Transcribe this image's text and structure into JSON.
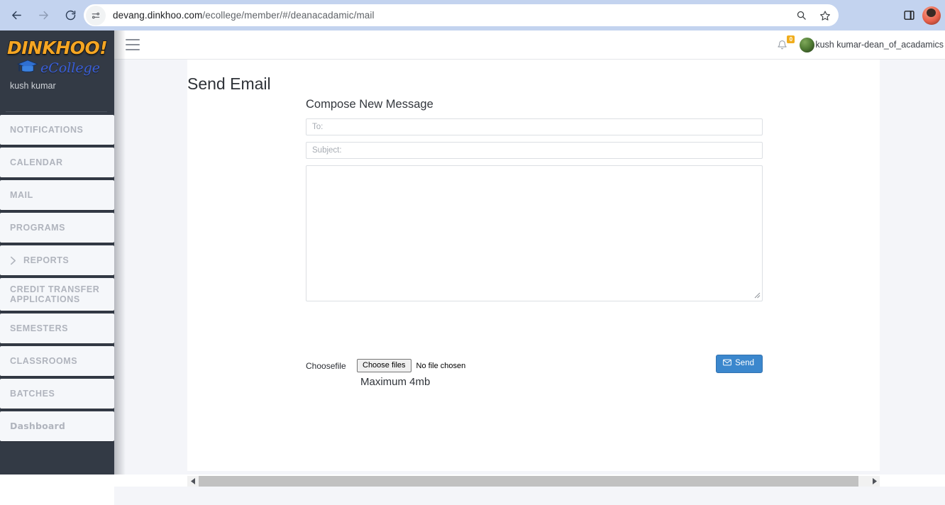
{
  "browser": {
    "url_bold": "devang.dinkhoo.com",
    "url_rest": "/ecollege/member/#/deanacadamic/mail",
    "back_icon": "back-arrow-icon",
    "forward_icon": "forward-arrow-icon",
    "reload_icon": "reload-icon",
    "site_info_icon": "site-settings-icon",
    "zoom_icon": "search-icon",
    "bookmark_icon": "bookmark-star-icon",
    "side_panel_icon": "side-panel-icon",
    "profile_icon": "profile-avatar"
  },
  "sidebar": {
    "logo_main": "DINKHOO!",
    "logo_sub": "eCollege",
    "username": "kush kumar",
    "items": [
      {
        "label": "NOTIFICATIONS",
        "has_chevron": false
      },
      {
        "label": "CALENDAR",
        "has_chevron": false
      },
      {
        "label": "MAIL",
        "has_chevron": false
      },
      {
        "label": "PROGRAMS",
        "has_chevron": false
      },
      {
        "label": "REPORTS",
        "has_chevron": true
      },
      {
        "label": "CREDIT TRANSFER APPLICATIONS",
        "has_chevron": false
      },
      {
        "label": "SEMESTERS",
        "has_chevron": false
      },
      {
        "label": "CLASSROOMS",
        "has_chevron": false
      },
      {
        "label": "BATCHES",
        "has_chevron": false
      },
      {
        "label": "Dashboard",
        "has_chevron": false
      }
    ]
  },
  "header": {
    "menu_toggle_icon": "hamburger-icon",
    "notification_icon": "bell-icon",
    "notification_count": "0",
    "user_name": "kush kumar-dean_of_acadamics"
  },
  "main": {
    "page_title": "Send Email",
    "compose_heading": "Compose New Message",
    "to_field": {
      "value": "",
      "placeholder": "To:"
    },
    "subject_field": {
      "value": "",
      "placeholder": "Subject:"
    },
    "message_field": {
      "value": "",
      "placeholder": ""
    },
    "choose_file_label": "Choosefile",
    "choose_files_button": "Choose files",
    "no_file_chosen": "No file chosen",
    "max_size_note": "Maximum 4mb",
    "send_button": "Send",
    "send_icon": "envelope-icon"
  },
  "colors": {
    "sidebar_bg": "#333a45",
    "nav_item_bg": "#f5f7fa",
    "send_button_bg": "#3b87cd",
    "badge_bg": "#f0ad1e",
    "logo_orange": "#F5A623",
    "logo_blue": "#3a5fd9"
  }
}
